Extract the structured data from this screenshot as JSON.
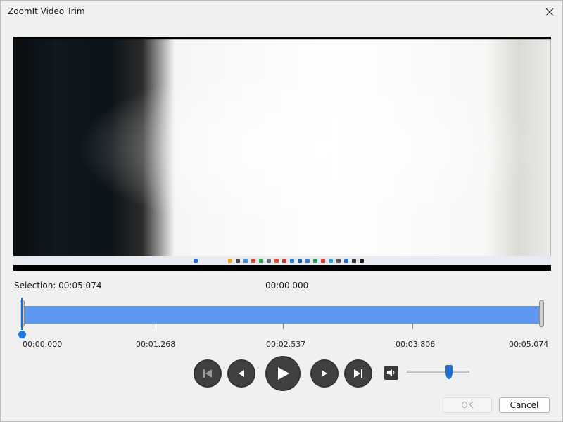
{
  "window": {
    "title": "ZoomIt Video Trim",
    "close_icon": "close-icon"
  },
  "video": {
    "preview_icon": "video-preview"
  },
  "timeline": {
    "selection_label": "Selection: 00:05.074",
    "current_time": "00:00.000",
    "ticks": [
      "00:00.000",
      "00:01.268",
      "00:02.537",
      "00:03.806",
      "00:05.074"
    ],
    "accent_color": "#5d97f0",
    "playhead_color": "#1e7be0"
  },
  "controls": {
    "skip_start_icon": "skip-to-start-icon",
    "step_back_icon": "step-back-icon",
    "play_icon": "play-icon",
    "step_forward_icon": "step-forward-icon",
    "skip_end_icon": "skip-to-end-icon",
    "volume_icon": "volume-icon",
    "volume_level": 0.62
  },
  "buttons": {
    "ok_label": "OK",
    "cancel_label": "Cancel"
  }
}
